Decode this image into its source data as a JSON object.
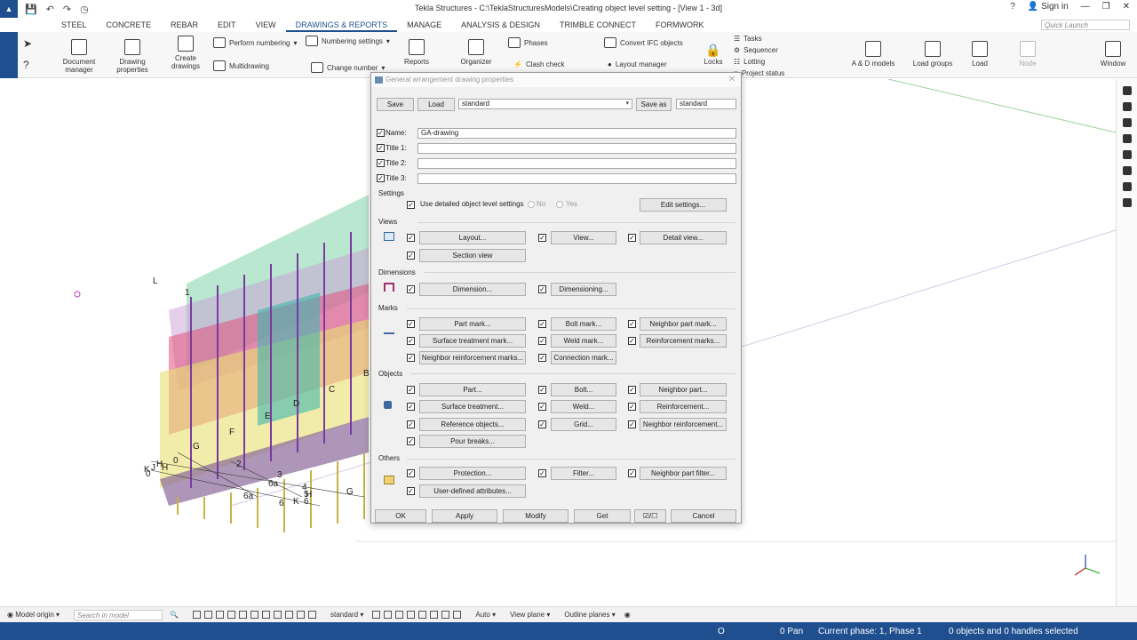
{
  "titlebar": {
    "title": "Tekla Structures - C:\\TeklaStructuresModels\\Creating object level setting - [View 1 - 3d]",
    "sign_in": "Sign in"
  },
  "menubar": {
    "tabs": [
      "STEEL",
      "CONCRETE",
      "REBAR",
      "EDIT",
      "VIEW",
      "DRAWINGS & REPORTS",
      "MANAGE",
      "ANALYSIS & DESIGN",
      "TRIMBLE CONNECT",
      "FORMWORK"
    ],
    "active_tab": "DRAWINGS & REPORTS",
    "quick_launch": "Quick Launch"
  },
  "ribbon": {
    "document_manager": "Document manager",
    "drawing_properties": "Drawing properties",
    "create_drawings": "Create drawings",
    "perform_numbering": "Perform numbering",
    "numbering_settings": "Numbering settings",
    "multidrawing": "Multidrawing",
    "change_number": "Change number",
    "reports": "Reports",
    "organizer": "Organizer",
    "phases": "Phases",
    "clash_check": "Clash check",
    "convert_ifc": "Convert IFC objects",
    "layout_manager": "Layout manager",
    "locks": "Locks",
    "tasks": "Tasks",
    "sequencer": "Sequencer",
    "lotting": "Lotting",
    "project_status": "Project status",
    "ad_models": "A & D models",
    "load_groups": "Load groups",
    "load": "Load",
    "node": "Node",
    "window": "Window"
  },
  "dialog": {
    "title": "General arrangement drawing properties",
    "save": "Save",
    "load": "Load",
    "preset": "standard",
    "save_as": "Save as",
    "save_as_value": "standard",
    "name_label": "Name:",
    "name_value": "GA-drawing",
    "title1_label": "Title 1:",
    "title2_label": "Title 2:",
    "title3_label": "Title 3:",
    "settings_section": "Settings",
    "use_detailed": "Use detailed object level settings",
    "no": "No",
    "yes": "Yes",
    "edit_settings": "Edit settings...",
    "views_section": "Views",
    "layout": "Layout...",
    "view": "View...",
    "detail_view": "Detail view...",
    "section_view": "Section view",
    "dimensions_section": "Dimensions",
    "dimension": "Dimension...",
    "dimensioning": "Dimensioning...",
    "marks_section": "Marks",
    "part_mark": "Part mark...",
    "bolt_mark": "Bolt mark...",
    "neighbor_part_mark": "Neighbor part mark...",
    "surface_treatment_mark": "Surface treatment mark...",
    "weld_mark": "Weld mark...",
    "reinforcement_marks": "Reinforcement marks...",
    "neighbor_reinforcement_marks": "Neighbor reinforcement marks...",
    "connection_mark": "Connection mark...",
    "objects_section": "Objects",
    "part": "Part...",
    "bolt": "Bolt...",
    "neighbor_part": "Neighbor part...",
    "surface_treatment": "Surface treatment...",
    "weld": "Weld...",
    "reinforcement": "Reinforcement...",
    "reference_objects": "Reference objects...",
    "grid": "Grid...",
    "neighbor_reinforcement": "Neighbor reinforcement...",
    "pour_breaks": "Pour breaks...",
    "others_section": "Others",
    "protection": "Protection...",
    "filter": "Filter...",
    "neighbor_part_filter": "Neighbor part filter...",
    "user_defined_attributes": "User-defined attributes...",
    "ok": "OK",
    "apply": "Apply",
    "modify": "Modify",
    "get": "Get",
    "cancel": "Cancel"
  },
  "bottombar": {
    "model_origin": "Model origin",
    "search": "Search in model",
    "standard": "standard",
    "auto": "Auto",
    "view_plane": "View plane",
    "outline_planes": "Outline planes"
  },
  "status": {
    "o": "O",
    "pan": "0 Pan",
    "phase": "Current phase: 1, Phase 1",
    "selection": "0 objects and 0 handles selected"
  },
  "model_labels": [
    "L",
    "H",
    "0",
    "K",
    "J",
    "H",
    "0",
    "G",
    "F",
    "E",
    "D",
    "C",
    "B",
    "2",
    "3",
    "4",
    "5",
    "6",
    "6a",
    "6a",
    "6",
    "K",
    "H",
    "G",
    "1"
  ],
  "colors": {
    "accent": "#1f4f8f"
  }
}
